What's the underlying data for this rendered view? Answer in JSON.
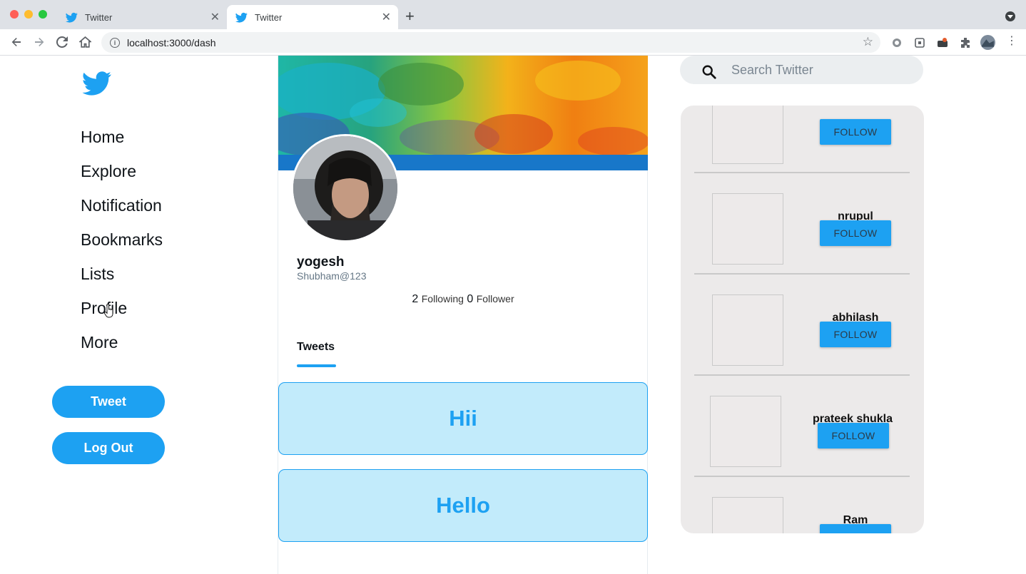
{
  "browser": {
    "tabs": [
      {
        "title": "Twitter",
        "active": false
      },
      {
        "title": "Twitter",
        "active": true
      }
    ],
    "url": "localhost:3000/dash"
  },
  "sidebar": {
    "items": [
      {
        "label": "Home"
      },
      {
        "label": "Explore"
      },
      {
        "label": "Notification"
      },
      {
        "label": "Bookmarks"
      },
      {
        "label": "Lists"
      },
      {
        "label": "Profile"
      },
      {
        "label": "More"
      }
    ],
    "tweet_button": "Tweet",
    "logout_button": "Log Out"
  },
  "profile": {
    "name": "yogesh",
    "handle": "Shubham@123",
    "following_count": "2",
    "following_label": "Following",
    "follower_count": "0",
    "follower_label": "Follower",
    "tab_label": "Tweets",
    "tweets": [
      {
        "text": "Hii"
      },
      {
        "text": "Hello"
      }
    ]
  },
  "search": {
    "placeholder": "Search Twitter"
  },
  "who_to_follow": {
    "follow_label": "FOLLOW",
    "users": [
      {
        "name": ""
      },
      {
        "name": "nrupul"
      },
      {
        "name": "abhilash"
      },
      {
        "name": "prateek shukla"
      },
      {
        "name": "Ram"
      }
    ]
  },
  "colors": {
    "accent": "#1da1f2",
    "tweet_bg": "#c2ebfb",
    "panel_bg": "#eceaea"
  }
}
